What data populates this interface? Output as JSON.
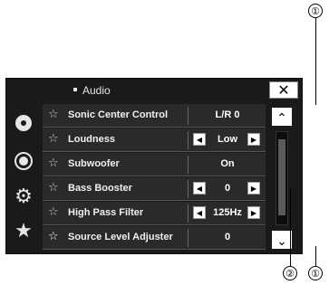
{
  "window": {
    "title": "Audio",
    "close_icon": "close-icon"
  },
  "sidebar": {
    "items": [
      {
        "icon": "disc-icon",
        "glyph": "●"
      },
      {
        "icon": "source-icon",
        "glyph": "◉"
      },
      {
        "icon": "settings-icon",
        "glyph": "⚙"
      },
      {
        "icon": "favorite-icon",
        "glyph": "★"
      }
    ]
  },
  "settings": {
    "rows": [
      {
        "label": "Sonic Center Control",
        "value": "L/R 0",
        "favorite": false,
        "arrows": "none"
      },
      {
        "label": "Loudness",
        "value": "Low",
        "favorite": false,
        "arrows": "both"
      },
      {
        "label": "Subwoofer",
        "value": "On",
        "favorite": false,
        "arrows": "none"
      },
      {
        "label": "Bass Booster",
        "value": "0",
        "favorite": false,
        "arrows": "both"
      },
      {
        "label": "High Pass Filter",
        "value": "125Hz",
        "favorite": false,
        "arrows": "both"
      },
      {
        "label": "Source Level Adjuster",
        "value": "0",
        "favorite": true,
        "arrows": "none"
      }
    ]
  },
  "scrollbar": {
    "up_icon": "chevron-up-icon",
    "down_icon": "chevron-down-icon",
    "up_glyph": "˄",
    "down_glyph": "˅"
  },
  "callouts": {
    "top": "①",
    "bottom_left": "②",
    "bottom_right": "①"
  },
  "colors": {
    "screen_bg": "#1a1a1a",
    "row_bg": "#2a2a2a",
    "text": "#f0f0f0",
    "button_bg": "#ffffff"
  }
}
